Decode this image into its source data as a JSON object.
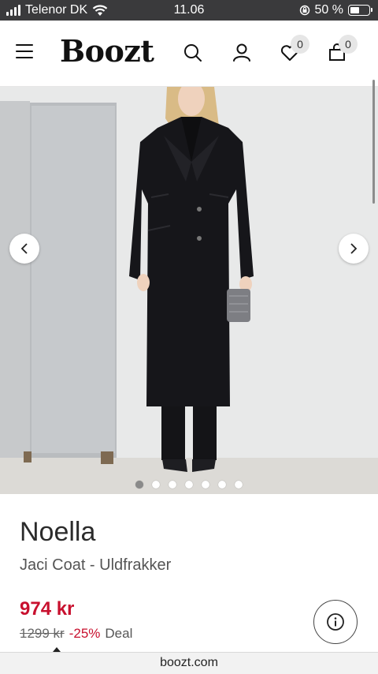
{
  "status_bar": {
    "carrier": "Telenor DK",
    "time": "11.06",
    "battery": "50 %",
    "battery_level": 0.5
  },
  "header": {
    "logo": "Boozt",
    "wishlist_count": "0",
    "cart_count": "0"
  },
  "gallery": {
    "image_count": 7,
    "active_index": 0
  },
  "product": {
    "brand": "Noella",
    "name": "Jaci Coat - Uldfrakker",
    "price": "974 kr",
    "old_price": "1299 kr",
    "discount": "-25%",
    "deal_label": "Deal"
  },
  "browser": {
    "url": "boozt.com"
  },
  "colors": {
    "accent": "#c8102e",
    "statusbar_bg": "#3a3a3c"
  }
}
